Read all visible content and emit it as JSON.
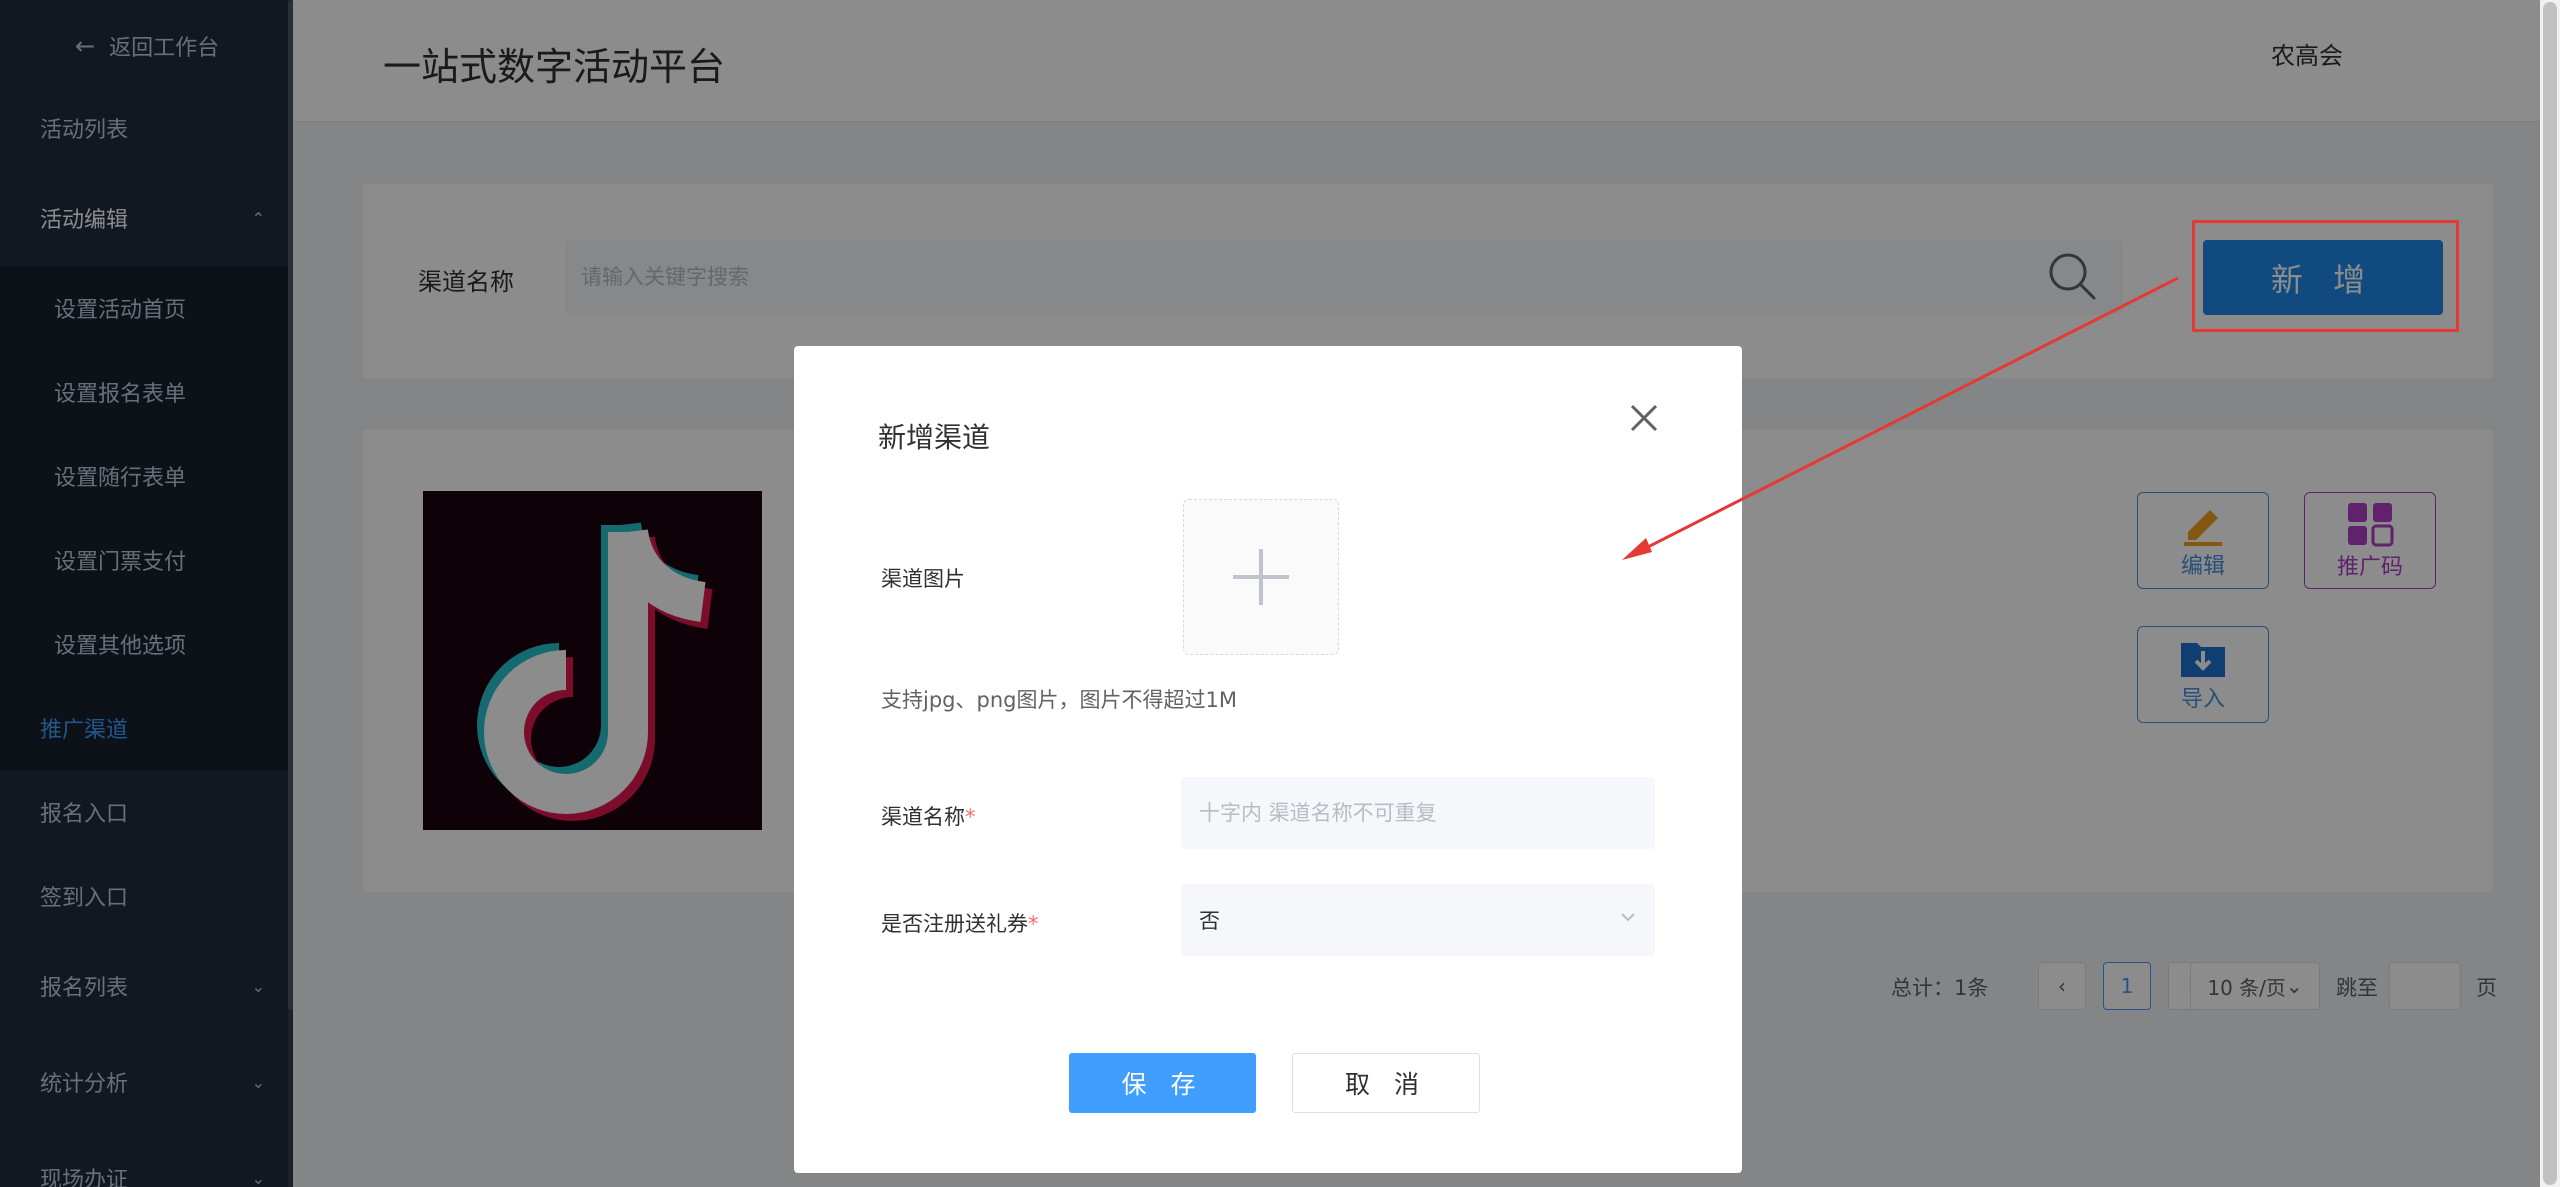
{
  "sidebar": {
    "back_label": "返回工作台",
    "items": [
      {
        "label": "活动列表"
      },
      {
        "label": "活动编辑"
      },
      {
        "label": "设置活动首页"
      },
      {
        "label": "设置报名表单"
      },
      {
        "label": "设置随行表单"
      },
      {
        "label": "设置门票支付"
      },
      {
        "label": "设置其他选项"
      },
      {
        "label": "推广渠道"
      },
      {
        "label": "报名入口"
      },
      {
        "label": "签到入口"
      },
      {
        "label": "报名列表"
      },
      {
        "label": "统计分析"
      },
      {
        "label": "现场办证"
      }
    ]
  },
  "header": {
    "title": "一站式数字活动平台",
    "user": "农高会"
  },
  "filter": {
    "label": "渠道名称",
    "placeholder": "请输入关键字搜索",
    "add_label": "新 增"
  },
  "list": {
    "actions": {
      "edit": "编辑",
      "qrcode": "推广码",
      "import": "导入"
    }
  },
  "pagination": {
    "total": "总计：1条",
    "current_page": "1",
    "page_size": "10 条/页",
    "jump_label": "跳至",
    "page_suffix": "页"
  },
  "modal": {
    "title": "新增渠道",
    "image_label": "渠道图片",
    "hint": "支持jpg、png图片，图片不得超过1M",
    "name_label": "渠道名称",
    "name_placeholder": "十字内 渠道名称不可重复",
    "gift_label": "是否注册送礼券",
    "gift_value": "否",
    "required_mark": "*",
    "save_label": "保 存",
    "cancel_label": "取 消"
  },
  "colors": {
    "sidebar_bg": "#1f2d3d",
    "primary": "#409eff",
    "add_button": "#1e88e5",
    "highlight": "#e53935"
  }
}
